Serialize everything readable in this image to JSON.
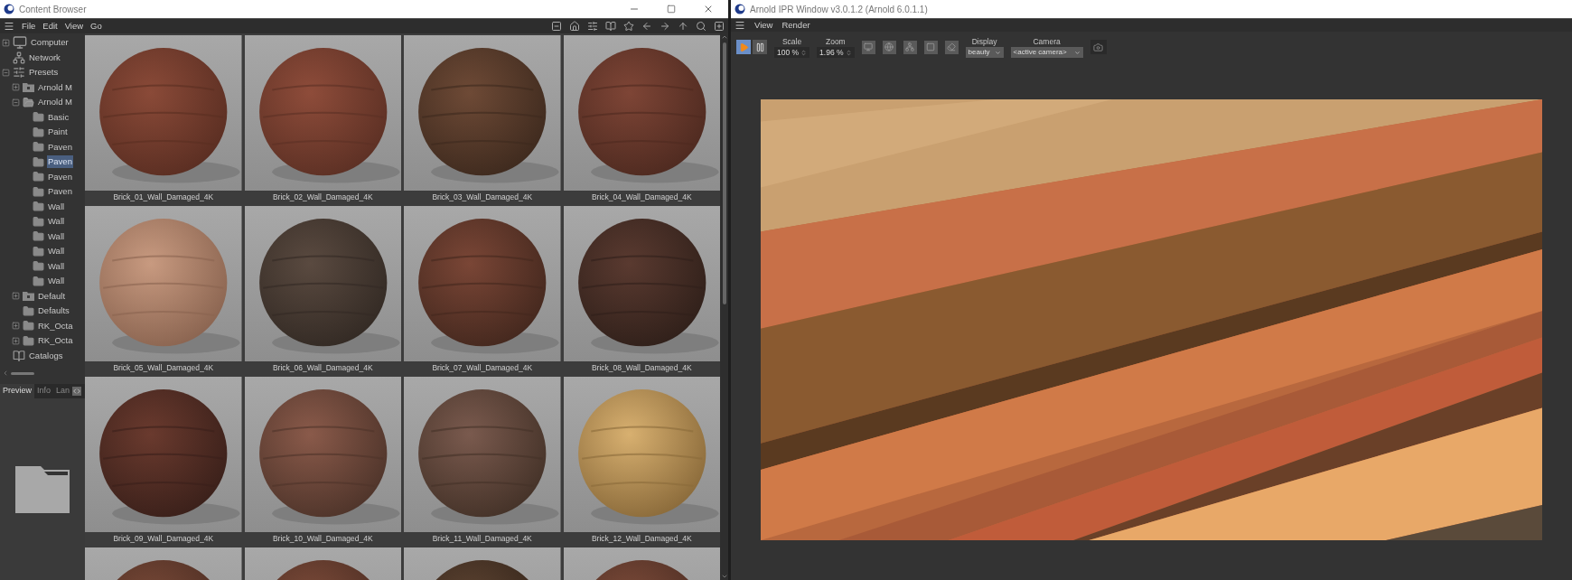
{
  "content_browser": {
    "title": "Content Browser",
    "menu": [
      "File",
      "Edit",
      "View",
      "Go"
    ],
    "tree": [
      {
        "label": "Computer",
        "kind": "computer",
        "expanded": false,
        "selected": false
      },
      {
        "label": "Network",
        "kind": "network",
        "selected": false
      },
      {
        "label": "Presets",
        "kind": "presets",
        "expanded": true,
        "selected": false,
        "children": [
          {
            "label": "Arnold M",
            "kind": "locked-folder",
            "expanded": false,
            "selected": false
          },
          {
            "label": "Arnold M",
            "kind": "open-folder",
            "expanded": true,
            "selected": false,
            "children": [
              {
                "label": "Basic",
                "kind": "folder",
                "selected": false
              },
              {
                "label": "Paint",
                "kind": "folder",
                "selected": false
              },
              {
                "label": "Paven",
                "kind": "folder",
                "selected": false
              },
              {
                "label": "Paven",
                "kind": "folder",
                "selected": true
              },
              {
                "label": "Paven",
                "kind": "folder",
                "selected": false
              },
              {
                "label": "Paven",
                "kind": "folder",
                "selected": false
              },
              {
                "label": "Wall",
                "kind": "folder",
                "selected": false
              },
              {
                "label": "Wall",
                "kind": "folder",
                "selected": false
              },
              {
                "label": "Wall",
                "kind": "folder",
                "selected": false
              },
              {
                "label": "Wall",
                "kind": "folder",
                "selected": false
              },
              {
                "label": "Wall",
                "kind": "folder",
                "selected": false
              },
              {
                "label": "Wall",
                "kind": "folder",
                "selected": false
              }
            ]
          },
          {
            "label": "Default",
            "kind": "locked-folder",
            "expanded": false,
            "selected": false
          },
          {
            "label": "Defaults",
            "kind": "folder",
            "selected": false
          },
          {
            "label": "RK_Octa",
            "kind": "folder",
            "expanded": false,
            "selected": false
          },
          {
            "label": "RK_Octa",
            "kind": "folder",
            "expanded": false,
            "selected": false
          }
        ]
      },
      {
        "label": "Catalogs",
        "kind": "catalog",
        "selected": false
      }
    ],
    "tabs": [
      {
        "label": "Preview",
        "selected": true
      },
      {
        "label": "Info",
        "selected": false
      },
      {
        "label": "Lan",
        "selected": false
      }
    ],
    "thumbnails": [
      {
        "kind": "material",
        "label": "Brick_01_Wall_Damaged_4K"
      },
      {
        "kind": "material",
        "label": "Brick_02_Wall_Damaged_4K"
      },
      {
        "kind": "material",
        "label": "Brick_03_Wall_Damaged_4K"
      },
      {
        "kind": "material",
        "label": "Brick_04_Wall_Damaged_4K"
      },
      {
        "kind": "material",
        "label": "Brick_05_Wall_Damaged_4K"
      },
      {
        "kind": "material",
        "label": "Brick_06_Wall_Damaged_4K"
      },
      {
        "kind": "material",
        "label": "Brick_07_Wall_Damaged_4K"
      },
      {
        "kind": "material",
        "label": "Brick_08_Wall_Damaged_4K"
      },
      {
        "kind": "material",
        "label": "Brick_09_Wall_Damaged_4K"
      },
      {
        "kind": "material",
        "label": "Brick_10_Wall_Damaged_4K"
      },
      {
        "kind": "material",
        "label": "Brick_11_Wall_Damaged_4K"
      },
      {
        "kind": "material",
        "label": "Brick_12_Wall_Damaged_4K"
      },
      {
        "kind": "partial"
      },
      {
        "kind": "partial"
      },
      {
        "kind": "partial"
      },
      {
        "kind": "partial"
      }
    ]
  },
  "ipr_window": {
    "title": "Arnold IPR Window v3.0.1.2 (Arnold 6.0.1.1)",
    "menu": [
      "View",
      "Render"
    ],
    "play": {
      "selected": true
    },
    "pause": {
      "selected": false
    },
    "scale": {
      "label": "Scale",
      "value": "100 %"
    },
    "zoom": {
      "label": "Zoom",
      "value": "1.96 %"
    },
    "display": {
      "label": "Display",
      "value": "beauty"
    },
    "camera": {
      "label": "Camera",
      "value": "<active camera>"
    }
  }
}
